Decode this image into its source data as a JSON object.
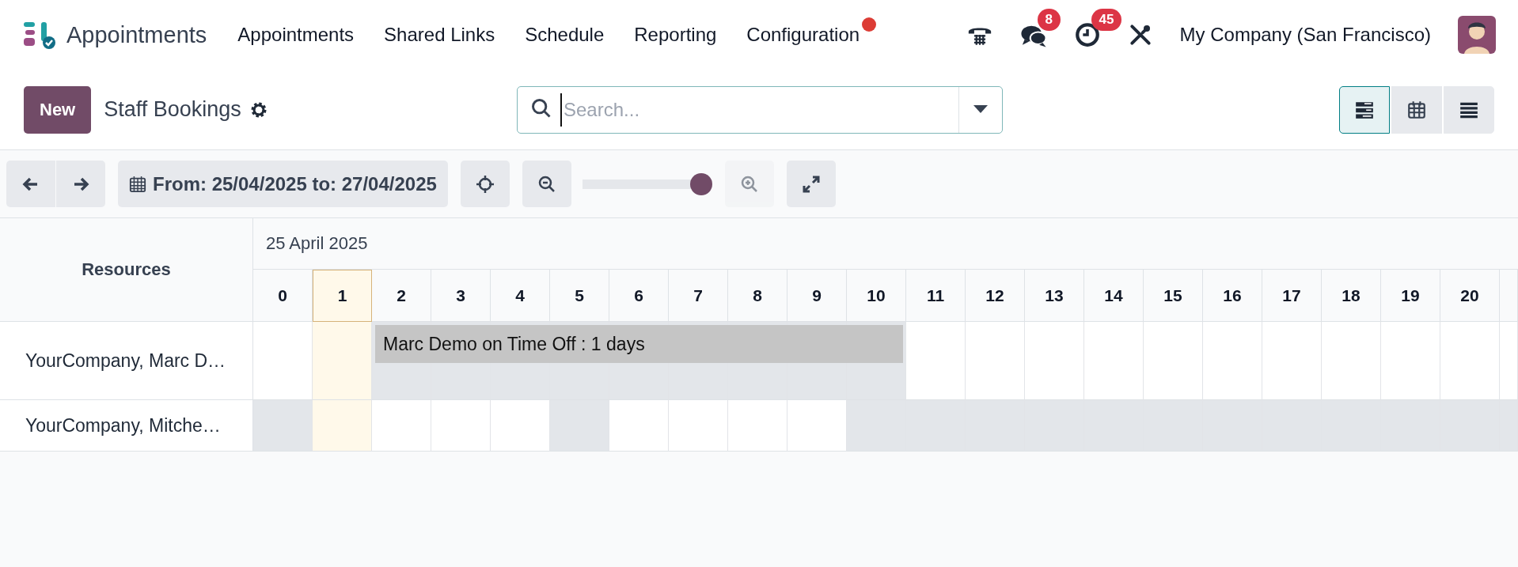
{
  "navbar": {
    "app_name": "Appointments",
    "menus": [
      "Appointments",
      "Shared Links",
      "Schedule",
      "Reporting",
      "Configuration"
    ],
    "messages_badge": "8",
    "activities_badge": "45",
    "company": "My Company (San Francisco)"
  },
  "control_panel": {
    "new_button": "New",
    "title": "Staff Bookings",
    "search": {
      "placeholder": "Search..."
    },
    "views": [
      {
        "kind": "gantt",
        "selected": true
      },
      {
        "kind": "calendar",
        "selected": false
      },
      {
        "kind": "list",
        "selected": false
      }
    ]
  },
  "toolbar": {
    "date_range": "From: 25/04/2025 to: 27/04/2025",
    "zoom": {
      "level": 1.0
    },
    "zoom_in": {
      "disabled": true
    },
    "zoom_out": {
      "disabled": false
    }
  },
  "gantt": {
    "resources_header": "Resources",
    "date_header": "25 April 2025",
    "columns": [
      {
        "label": "0",
        "today": false
      },
      {
        "label": "1",
        "today": true
      },
      {
        "label": "2",
        "today": false
      },
      {
        "label": "3",
        "today": false
      },
      {
        "label": "4",
        "today": false
      },
      {
        "label": "5",
        "today": false
      },
      {
        "label": "6",
        "today": false
      },
      {
        "label": "7",
        "today": false
      },
      {
        "label": "8",
        "today": false
      },
      {
        "label": "9",
        "today": false
      },
      {
        "label": "10",
        "today": false
      },
      {
        "label": "11",
        "today": false
      },
      {
        "label": "12",
        "today": false
      },
      {
        "label": "13",
        "today": false
      },
      {
        "label": "14",
        "today": false
      },
      {
        "label": "15",
        "today": false
      },
      {
        "label": "16",
        "today": false
      },
      {
        "label": "17",
        "today": false
      },
      {
        "label": "18",
        "today": false
      },
      {
        "label": "19",
        "today": false
      },
      {
        "label": "20",
        "today": false
      }
    ],
    "rows": [
      {
        "name": "YourCompany, Marc D…",
        "cells": [
          {
            "off": false
          },
          {},
          {
            "off": true,
            "event": "Marc Demo on Time Off : 1 days"
          },
          {
            "off": true
          },
          {
            "off": true
          },
          {
            "off": true
          },
          {
            "off": true
          },
          {
            "off": true
          },
          {
            "off": true
          },
          {
            "off": true
          },
          {
            "off": true,
            "event_end": true
          },
          {
            "off": false
          },
          {
            "off": false
          },
          {
            "off": false
          },
          {
            "off": false
          },
          {
            "off": false
          },
          {
            "off": false
          },
          {
            "off": false
          },
          {
            "off": false
          },
          {
            "off": false
          },
          {
            "off": false
          }
        ]
      },
      {
        "name": "YourCompany, Mitche…",
        "cells": [
          {
            "off": true
          },
          {},
          {
            "off": false
          },
          {
            "off": false
          },
          {
            "off": false
          },
          {
            "off": true
          },
          {
            "off": false
          },
          {
            "off": false
          },
          {
            "off": false
          },
          {
            "off": false
          },
          {
            "off": true
          },
          {
            "off": true
          },
          {
            "off": true
          },
          {
            "off": true
          },
          {
            "off": true
          },
          {
            "off": true
          },
          {
            "off": true
          },
          {
            "off": true
          },
          {
            "off": true
          },
          {
            "off": true
          },
          {
            "off": true
          }
        ]
      }
    ]
  }
}
